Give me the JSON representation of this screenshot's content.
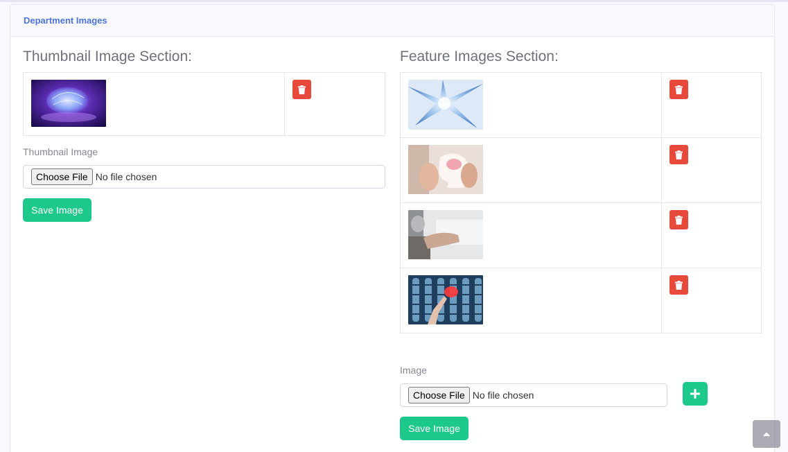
{
  "header": {
    "title": "Department Images"
  },
  "thumbnail_section": {
    "title": "Thumbnail Image Section:",
    "images": [
      {
        "alt": "brain-glow-image",
        "icon": "trash-icon"
      }
    ],
    "field_label": "Thumbnail Image",
    "choose_label": "Choose File",
    "no_file_text": "No file chosen",
    "save_label": "Save Image"
  },
  "feature_section": {
    "title": "Feature Images Section:",
    "images": [
      {
        "alt": "neuron-blue-image",
        "icon": "trash-icon"
      },
      {
        "alt": "paper-head-brain-image",
        "icon": "trash-icon"
      },
      {
        "alt": "elderly-hand-image",
        "icon": "trash-icon"
      },
      {
        "alt": "spine-xray-image",
        "icon": "trash-icon"
      }
    ],
    "field_label": "Image",
    "choose_label": "Choose File",
    "no_file_text": "No file chosen",
    "save_label": "Save Image",
    "add_icon": "plus-icon"
  },
  "scroll_top_icon": "chevron-up-icon",
  "colors": {
    "primary": "#4e73df",
    "danger": "#e74a3b",
    "success": "#1cc88a",
    "text_muted": "#858796"
  }
}
